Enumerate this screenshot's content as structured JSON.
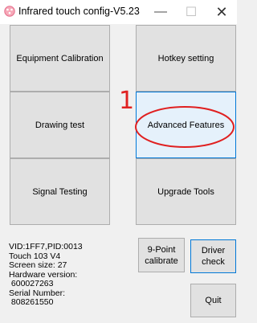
{
  "window": {
    "title": "Infrared touch config-V5.23",
    "minimize_glyph": "—",
    "maximize_glyph": "☐",
    "close_glyph": "✕"
  },
  "buttons": {
    "equipment_calibration": "Equipment Calibration",
    "hotkey_setting": "Hotkey setting",
    "drawing_test": "Drawing test",
    "advanced_features": "Advanced Features",
    "signal_testing": "Signal Testing",
    "upgrade_tools": "Upgrade Tools",
    "nine_point_calibrate": "9-Point\ncalibrate",
    "driver_check": "Driver check",
    "quit": "Quit"
  },
  "device_info": {
    "line1": "VID:1FF7,PID:0013",
    "line2": "Touch 103 V4",
    "line3": "Screen size: 27",
    "line4": "Hardware version:",
    "line5": " 600027263",
    "line6": "Serial Number:",
    "line7": " 808261550"
  },
  "annotation": {
    "number": "1",
    "color": "#e02020"
  },
  "colors": {
    "button_face": "#e1e1e1",
    "button_border": "#adadad",
    "focus_border": "#0078d7",
    "window_bg": "#f0f0f0"
  }
}
